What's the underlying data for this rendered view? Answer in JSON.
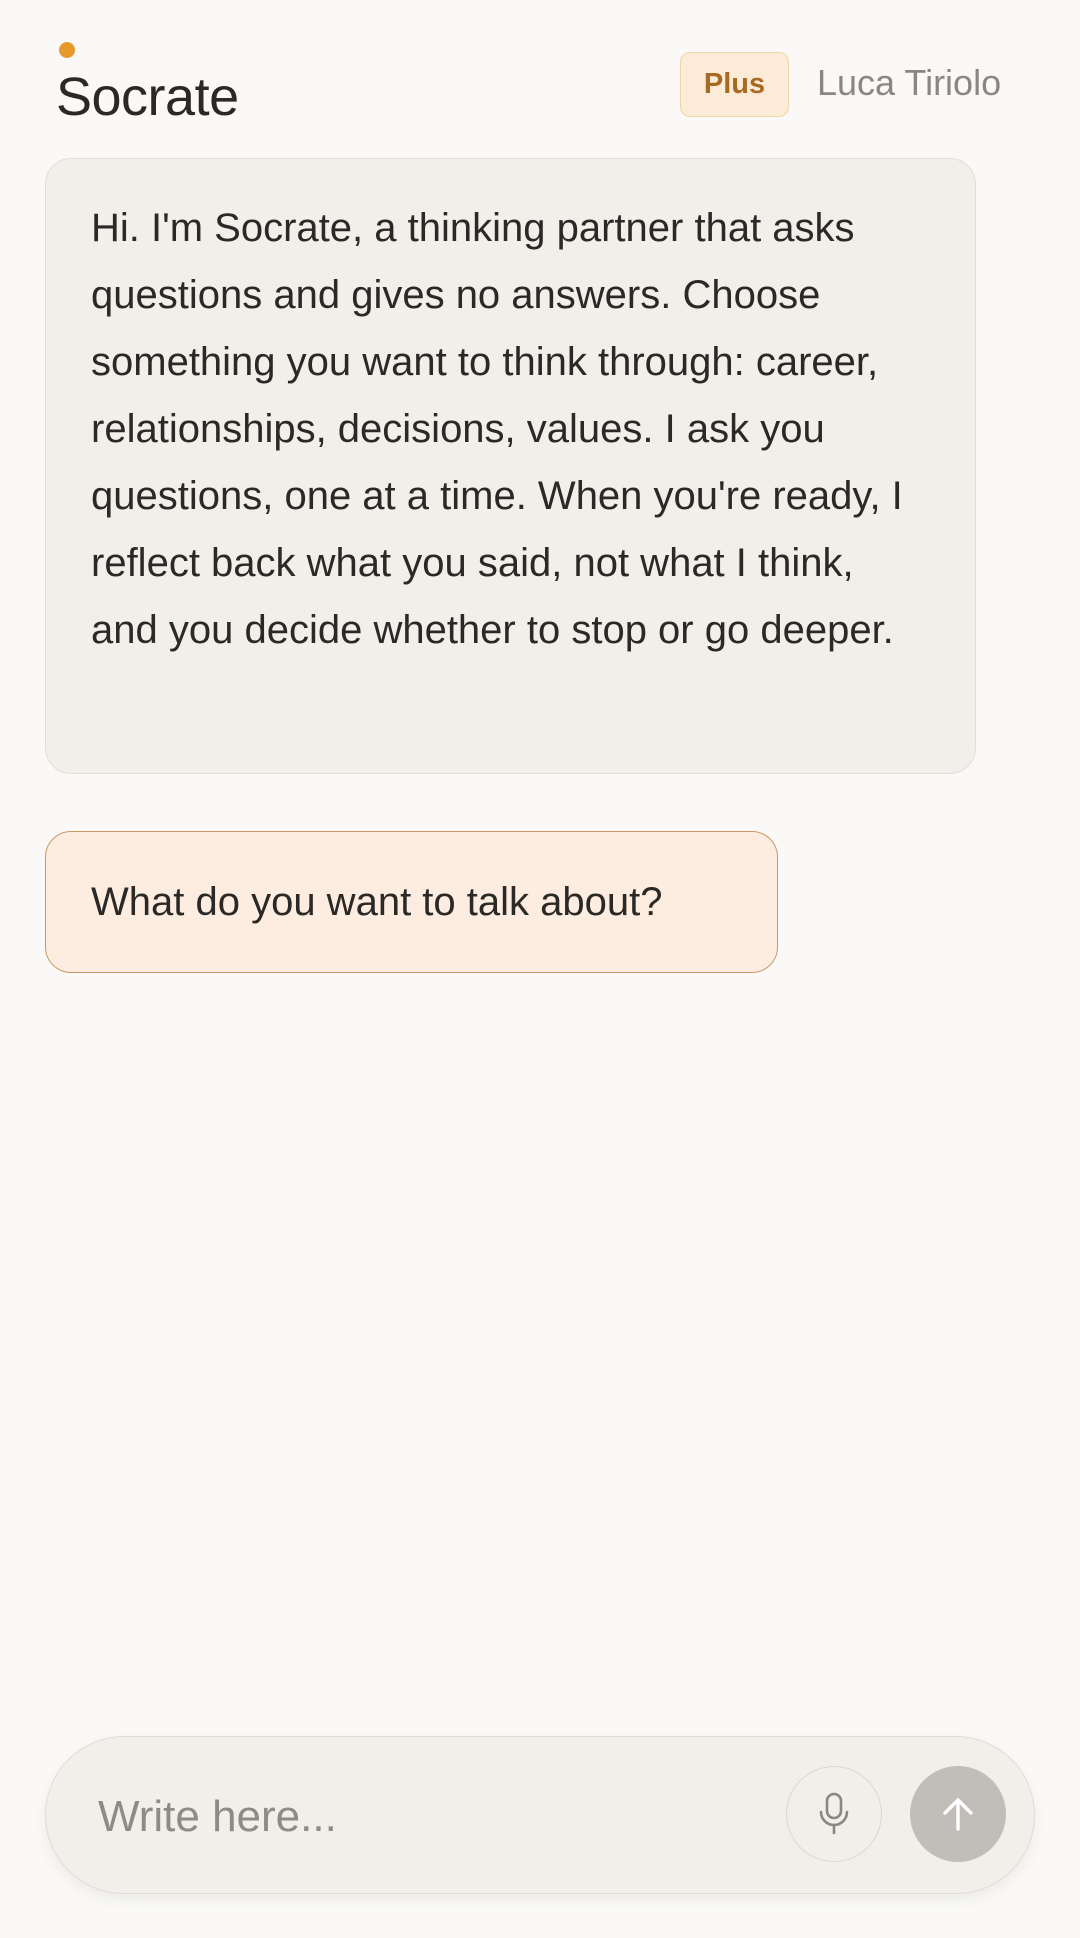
{
  "header": {
    "app_title": "Socrate",
    "plan_badge": "Plus",
    "user_name": "Luca Tiriolo",
    "brand_dot_color": "#e69a2e"
  },
  "messages": [
    {
      "role": "assistant",
      "text": "Hi. I'm Socrate, a thinking partner that asks questions and gives no answers. Choose something you want to think through: career, relationships, decisions, values. I ask you questions, one at a time. When you're ready, I reflect back what you said, not what I think, and you decide whether to stop or go deeper."
    },
    {
      "role": "assistant-question",
      "text": "What do you want to talk about?"
    }
  ],
  "composer": {
    "value": "",
    "placeholder": "Write here...",
    "mic_icon": "microphone-icon",
    "send_icon": "arrow-up-icon"
  },
  "colors": {
    "accent": "#e69a2e",
    "badge_text": "#a86a22",
    "question_bg": "#fcede0",
    "question_border": "#c89a62",
    "send_disabled": "#c1beb9"
  }
}
